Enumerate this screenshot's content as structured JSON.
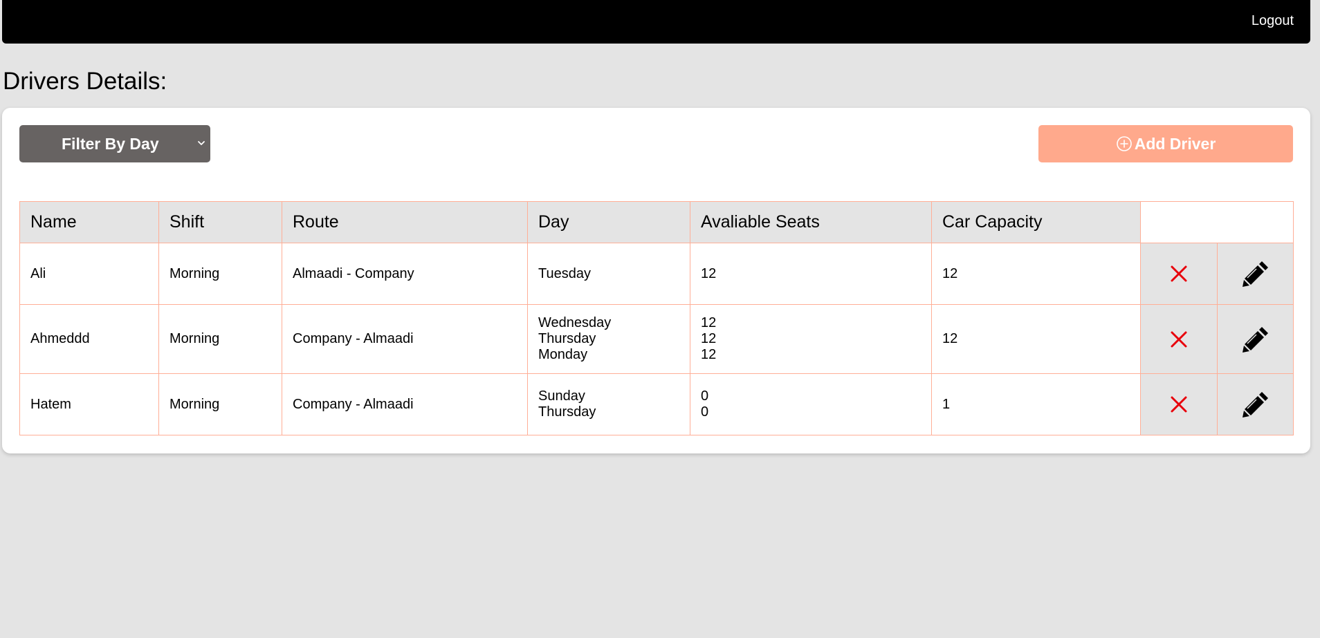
{
  "header": {
    "logout_label": "Logout"
  },
  "page": {
    "title": "Drivers Details:"
  },
  "toolbar": {
    "filter_label": "Filter By Day",
    "add_label": "Add Driver"
  },
  "table": {
    "columns": [
      "Name",
      "Shift",
      "Route",
      "Day",
      "Avaliable Seats",
      "Car Capacity"
    ],
    "rows": [
      {
        "name": "Ali",
        "shift": "Morning",
        "route": "Almaadi - Company",
        "days": [
          "Tuesday"
        ],
        "seats": [
          "12"
        ],
        "capacity": "12"
      },
      {
        "name": "Ahmeddd",
        "shift": "Morning",
        "route": "Company - Almaadi",
        "days": [
          "Wednesday",
          "Thursday",
          "Monday"
        ],
        "seats": [
          "12",
          "12",
          "12"
        ],
        "capacity": "12"
      },
      {
        "name": "Hatem",
        "shift": "Morning",
        "route": "Company - Almaadi",
        "days": [
          "Sunday",
          "Thursday"
        ],
        "seats": [
          "0",
          "0"
        ],
        "capacity": "1"
      }
    ]
  },
  "icons": {
    "delete": "close-icon",
    "edit": "pencil-icon",
    "add": "plus-circle-icon",
    "dropdown": "chevron-down-icon"
  },
  "colors": {
    "topbar": "#000000",
    "page_bg": "#e4e4e4",
    "filter_bg": "#676362",
    "add_bg": "#ffa98c",
    "table_border": "#ffae96",
    "delete_icon": "#e8000b"
  }
}
